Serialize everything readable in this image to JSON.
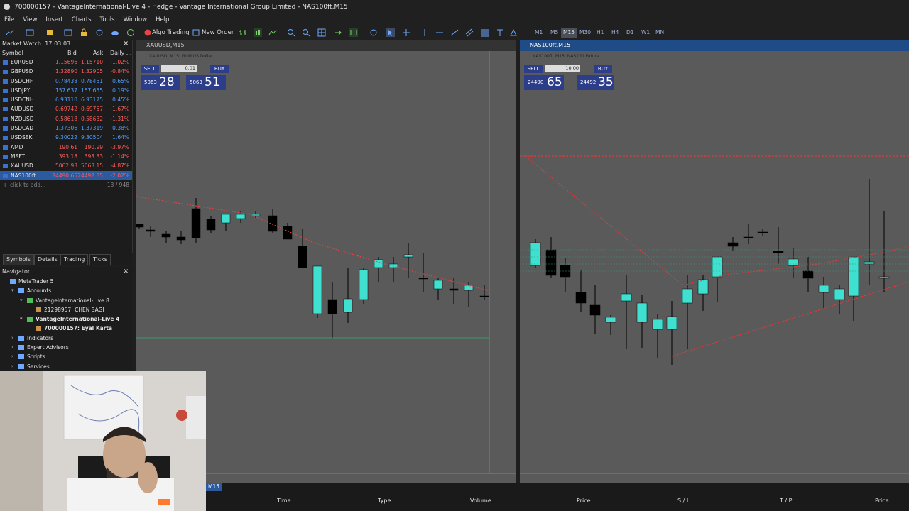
{
  "window": {
    "title": "700000157 - VantageInternational-Live 4 - Hedge - Vantage International Group Limited - NAS100ft,M15"
  },
  "menu": [
    "File",
    "View",
    "Insert",
    "Charts",
    "Tools",
    "Window",
    "Help"
  ],
  "toolbar": {
    "algo_trading": "Algo Trading",
    "new_order": "New Order",
    "timeframes": [
      "M1",
      "M5",
      "M15",
      "M30",
      "H1",
      "H4",
      "D1",
      "W1",
      "MN"
    ],
    "active_timeframe": "M15"
  },
  "market_watch": {
    "title": "Market Watch: 17:03:03",
    "columns": {
      "symbol": "Symbol",
      "bid": "Bid",
      "ask": "Ask",
      "daily": "Daily ..."
    },
    "rows": [
      {
        "symbol": "EURUSD",
        "bid": "1.15696",
        "ask": "1.15710",
        "change": "-1.02%"
      },
      {
        "symbol": "GBPUSD",
        "bid": "1.32890",
        "ask": "1.32905",
        "change": "-0.84%"
      },
      {
        "symbol": "USDCHF",
        "bid": "0.78438",
        "ask": "0.78451",
        "change": "0.65%"
      },
      {
        "symbol": "USDJPY",
        "bid": "157.637",
        "ask": "157.655",
        "change": "0.19%"
      },
      {
        "symbol": "USDCNH",
        "bid": "6.93110",
        "ask": "6.93175",
        "change": "0.45%"
      },
      {
        "symbol": "AUDUSD",
        "bid": "0.69742",
        "ask": "0.69757",
        "change": "-1.67%"
      },
      {
        "symbol": "NZDUSD",
        "bid": "0.58618",
        "ask": "0.58632",
        "change": "-1.31%"
      },
      {
        "symbol": "USDCAD",
        "bid": "1.37306",
        "ask": "1.37319",
        "change": "0.38%"
      },
      {
        "symbol": "USDSEK",
        "bid": "9.30022",
        "ask": "9.30504",
        "change": "1.64%"
      },
      {
        "symbol": "AMD",
        "bid": "190.61",
        "ask": "190.99",
        "change": "-3.97%"
      },
      {
        "symbol": "MSFT",
        "bid": "393.18",
        "ask": "393.33",
        "change": "-1.14%"
      },
      {
        "symbol": "XAUUSD",
        "bid": "5062.93",
        "ask": "5063.15",
        "change": "-4.87%"
      },
      {
        "symbol": "NAS100ft",
        "bid": "24490.65",
        "ask": "24492.35",
        "change": "-2.02%"
      }
    ],
    "add_label": "click to add...",
    "count": "13 / 948",
    "tabs": [
      "Symbols",
      "Details",
      "Trading",
      "Ticks"
    ]
  },
  "navigator": {
    "title": "Navigator",
    "items": [
      {
        "label": "MetaTrader 5",
        "indent": 0
      },
      {
        "label": "Accounts",
        "indent": 1
      },
      {
        "label": "VantageInternational-Live 8",
        "indent": 2
      },
      {
        "label": "21298957: CHEN SAGI",
        "indent": 3
      },
      {
        "label": "VantageInternational-Live 4",
        "indent": 2
      },
      {
        "label": "700000157: Eyal Karta",
        "indent": 3
      },
      {
        "label": "Indicators",
        "indent": 1
      },
      {
        "label": "Expert Advisors",
        "indent": 1
      },
      {
        "label": "Scripts",
        "indent": 1
      },
      {
        "label": "Services",
        "indent": 1
      }
    ]
  },
  "charts": [
    {
      "title": "XAUUSD,M15",
      "sell_label": "SELL",
      "buy_label": "BUY",
      "lot": "0.01",
      "sell_small": "5063",
      "sell_big": "28",
      "buy_small": "5063",
      "buy_big": "51"
    },
    {
      "title": "NAS100ft,M15",
      "sell_label": "SELL",
      "buy_label": "BUY",
      "lot": "10.00",
      "sell_small": "24490",
      "sell_big": "65",
      "buy_small": "24492",
      "buy_big": "35"
    }
  ],
  "bottom": {
    "tab": "M15",
    "columns": [
      "Time",
      "Type",
      "Volume",
      "Price",
      "S / L",
      "T / P",
      "Price"
    ]
  },
  "colors": {
    "bg": "#1e1e1e",
    "chart_bg": "#5a5a5a",
    "bull": "#40e0d0",
    "bear": "#000000",
    "trend": "#ff3333",
    "selected": "#2b5a9e"
  }
}
